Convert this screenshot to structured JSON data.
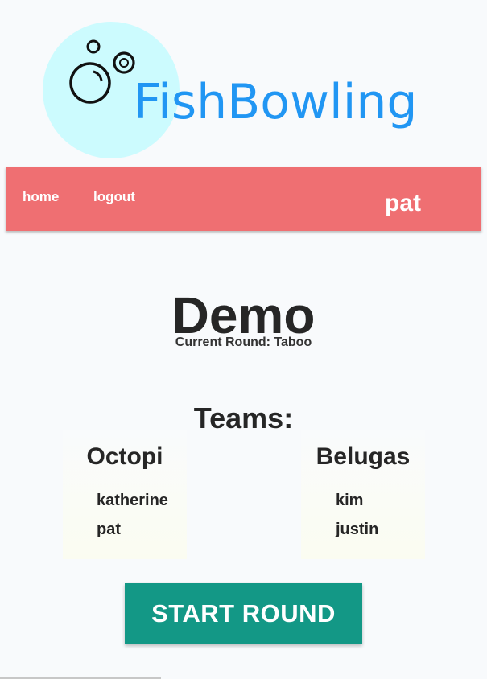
{
  "logo": {
    "text": "FishBowling",
    "icon": "bubbles-icon",
    "circle_color": "#ccfbfe",
    "text_color": "#2196f3"
  },
  "nav": {
    "background": "#ef6f72",
    "home_label": "home",
    "logout_label": "logout",
    "username": "pat"
  },
  "game": {
    "title": "Demo",
    "current_round_label": "Current Round: Taboo"
  },
  "teams": {
    "heading": "Teams:",
    "list": [
      {
        "name": "Octopi",
        "members": [
          "katherine",
          "pat"
        ]
      },
      {
        "name": "Belugas",
        "members": [
          "kim",
          "justin"
        ]
      }
    ]
  },
  "actions": {
    "start_round_label": "START ROUND",
    "button_color": "#139886"
  }
}
